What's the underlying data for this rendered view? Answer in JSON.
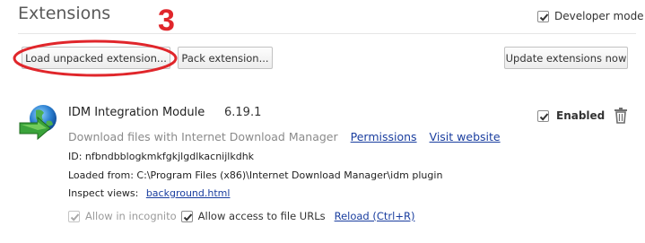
{
  "header": {
    "title": "Extensions",
    "developer_mode_label": "Developer mode",
    "developer_mode_checked": true
  },
  "toolbar": {
    "load_unpacked_label": "Load unpacked extension...",
    "pack_label": "Pack extension...",
    "update_label": "Update extensions now"
  },
  "annotation": {
    "step_number": "3",
    "color": "#e0262b"
  },
  "extension": {
    "icon": "idm-globe-icon",
    "name": "IDM Integration Module",
    "version": "6.19.1",
    "description": "Download files with Internet Download Manager",
    "permissions_link": "Permissions",
    "website_link": "Visit website",
    "id_text": "ID: nfbndbblogkmkfgkjlgdlkacnijlkdhk",
    "loaded_from_text": "Loaded from: C:\\Program Files (x86)\\Internet Download Manager\\idm plugin",
    "inspect_views_label": "Inspect views:",
    "inspect_views_link": "background.html",
    "allow_incognito_label": "Allow in incognito",
    "allow_incognito_checked": true,
    "allow_incognito_disabled": true,
    "allow_file_urls_label": "Allow access to file URLs",
    "allow_file_urls_checked": true,
    "reload_link": "Reload (Ctrl+R)",
    "enabled_label": "Enabled",
    "enabled_checked": true
  },
  "colors": {
    "link": "#1a3e9f",
    "muted_text": "#8a8a8a",
    "annotation_red": "#e0262b"
  }
}
